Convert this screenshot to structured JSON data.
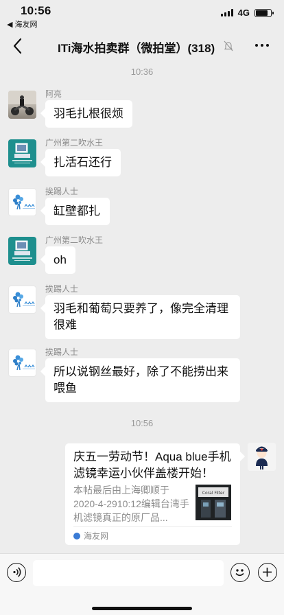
{
  "status_bar": {
    "time": "10:56",
    "back_app": "◀ 海友网",
    "network": "4G"
  },
  "nav": {
    "title": "ITi海水拍卖群（微拍堂）(318)",
    "back_icon": "chevron-left-icon",
    "more_icon": "more-dots-icon",
    "mute_icon": "mute-bell-icon"
  },
  "chat": {
    "time_dividers": [
      "10:36",
      "10:56"
    ],
    "messages": [
      {
        "sender": "阿亮",
        "text": "羽毛扎根很烦",
        "avatar": "motorcycle-avatar"
      },
      {
        "sender": "广州第二吹水王",
        "text": "扎活石还行",
        "avatar": "computer-avatar"
      },
      {
        "sender": "挨踢人士",
        "text": "缸壁都扎",
        "avatar": "coral-avatar"
      },
      {
        "sender": "广州第二吹水王",
        "text": "oh",
        "avatar": "computer-avatar"
      },
      {
        "sender": "挨踢人士",
        "text": "羽毛和葡萄只要养了，像完全清理很难",
        "avatar": "coral-avatar"
      },
      {
        "sender": "挨踢人士",
        "text": "所以说钢丝最好，除了不能捞出来喂鱼",
        "avatar": "coral-avatar"
      }
    ],
    "link_card": {
      "title": "庆五一劳动节！Aqua blue手机滤镜幸运小伙伴盖楼开始！",
      "description": "本帖最后由上海卿顺于2020-4-2910:12编辑台湾手机滤镜真正的原厂品...",
      "thumb_text": "Coral Filter",
      "source": "海友网",
      "source_icon": "site-logo-icon"
    }
  },
  "input_bar": {
    "voice_icon": "voice-icon",
    "emoji_icon": "emoji-icon",
    "plus_icon": "plus-icon",
    "input_value": ""
  },
  "colors": {
    "background": "#ededed",
    "bubble": "#ffffff",
    "meta_text": "#9a9a9a",
    "avatar_teal": "#1e8f8e"
  }
}
